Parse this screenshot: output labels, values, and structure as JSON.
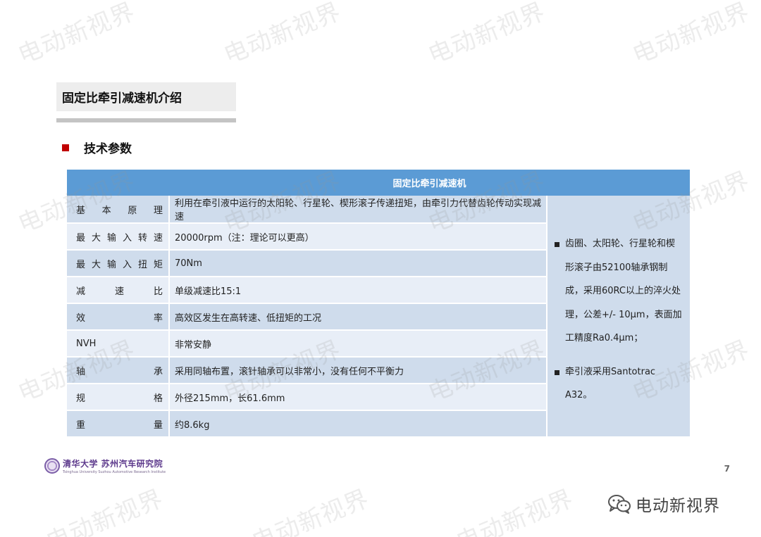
{
  "watermark": "电动新视界",
  "slide": {
    "title": "固定比牵引减速机介绍",
    "section": "技术参数",
    "page_number": "7"
  },
  "table": {
    "header": "固定比牵引减速机",
    "rows": [
      {
        "label": "基本原理",
        "value": "利用在牵引液中运行的太阳轮、行星轮、楔形滚子传递扭矩，由牵引力代替齿轮传动实现减速"
      },
      {
        "label": "最大输入转速",
        "value": "20000rpm（注：理论可以更高）"
      },
      {
        "label": "最大输入扭矩",
        "value": "70Nm"
      },
      {
        "label": "减速比",
        "value": "单级减速比15:1"
      },
      {
        "label": "效率",
        "value": "高效区发生在高转速、低扭矩的工况"
      },
      {
        "label": "NVH",
        "value": "非常安静"
      },
      {
        "label": "轴承",
        "value": "采用同轴布置，滚针轴承可以非常小，没有任何不平衡力"
      },
      {
        "label": "规格",
        "value": "外径215mm，长61.6mm"
      },
      {
        "label": "重量",
        "value": "约8.6kg"
      }
    ],
    "notes": [
      "齿圈、太阳轮、行星轮和楔形滚子由52100轴承钢制成，采用60RC以上的淬火处理，公差+/- 10μm，表面加工精度Ra0.4μm；",
      "牵引液采用Santotrac A32。"
    ]
  },
  "footer": {
    "logo_text": "清华大学 苏州汽车研究院",
    "logo_subtext": "Tsinghua University Suzhou Automotive Research Institute"
  },
  "brand": {
    "icon": "wechat-icon",
    "text": "电动新视界"
  },
  "colors": {
    "header_blue": "#5b9bd5",
    "row_dark": "#cfdcec",
    "row_light": "#e8eef7",
    "bullet_red": "#c00000"
  }
}
